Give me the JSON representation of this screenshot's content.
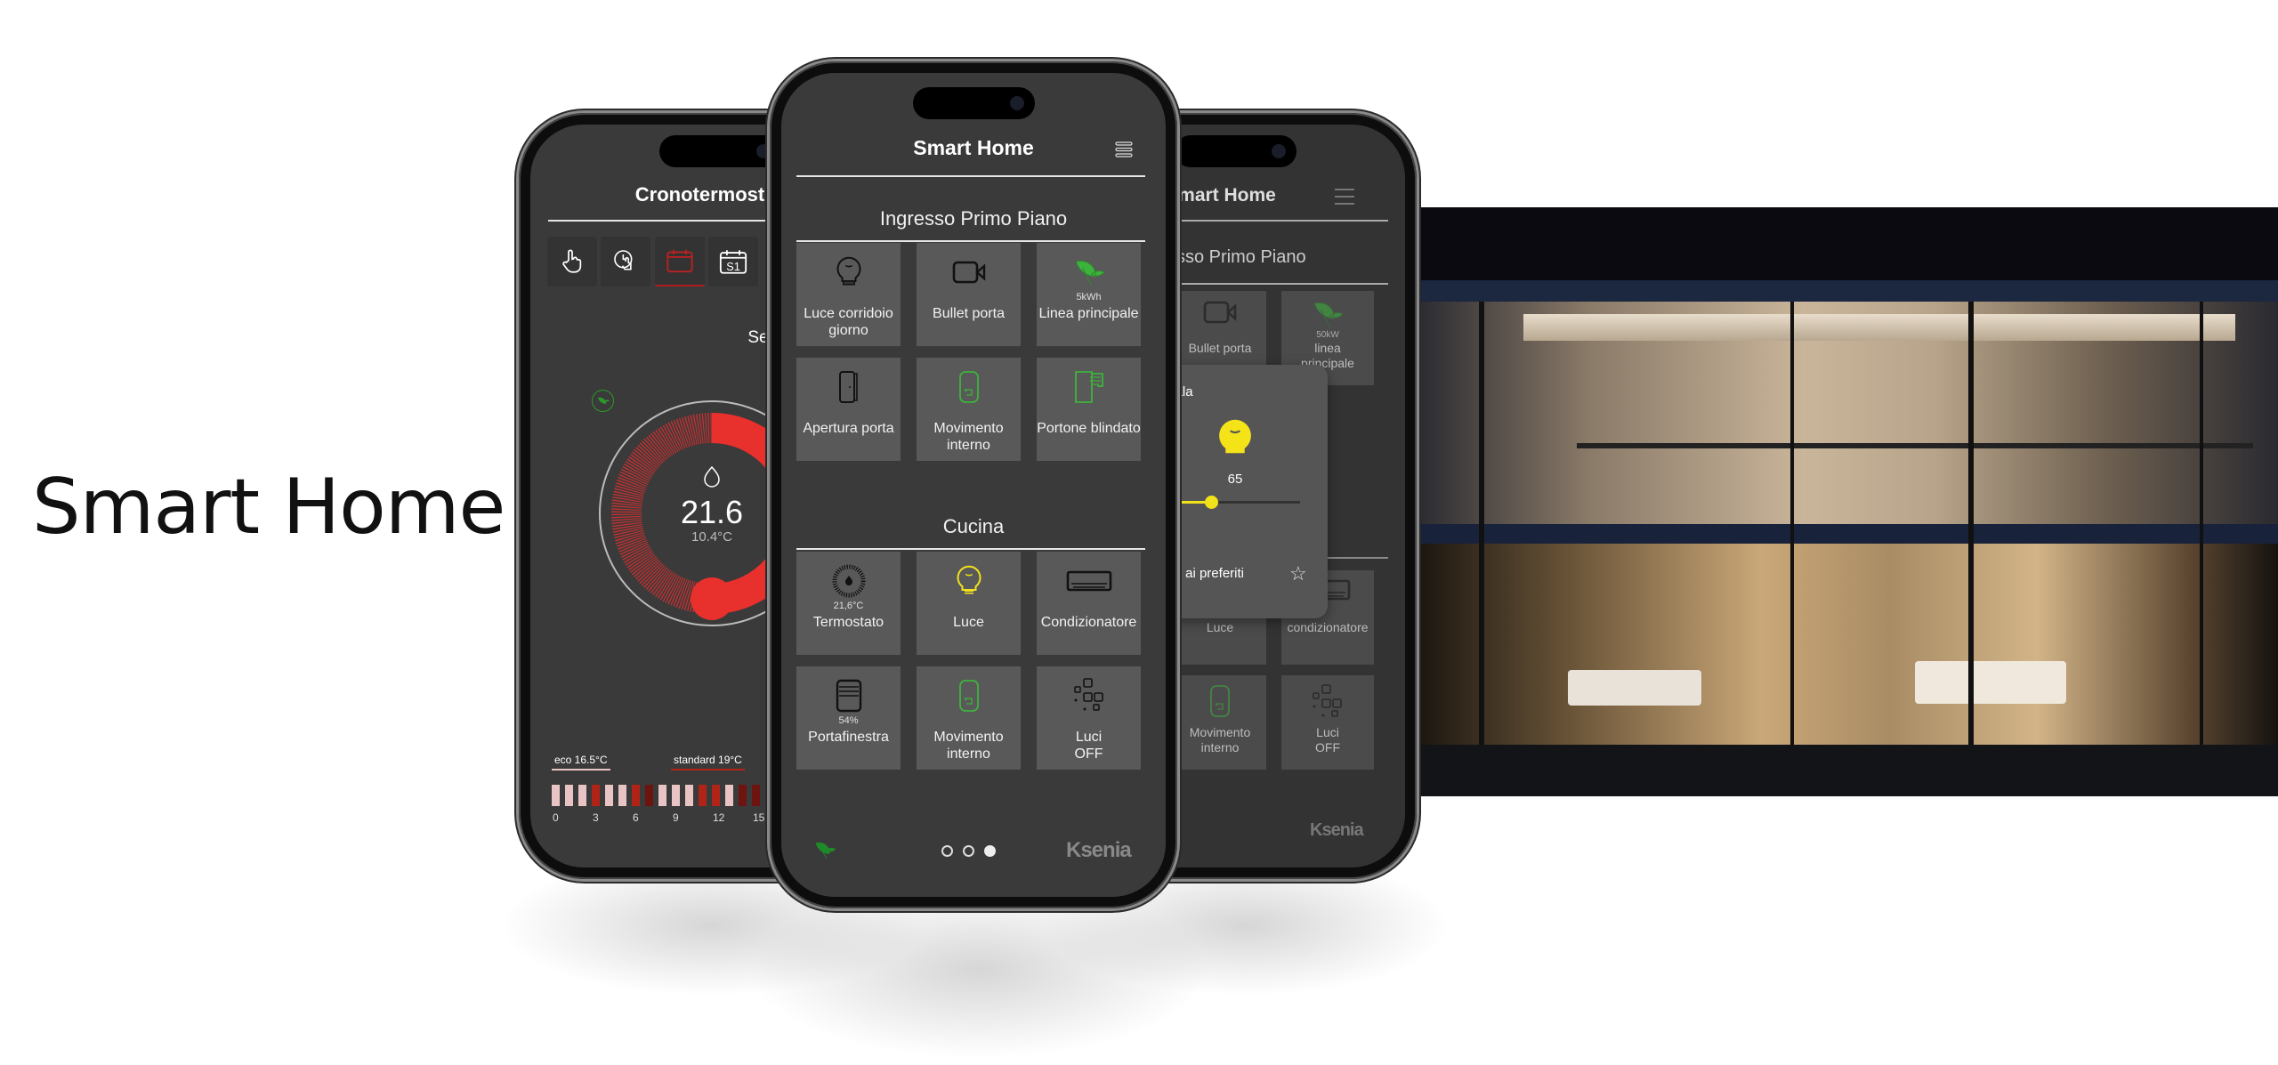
{
  "hero_title": "Smart Home",
  "colors": {
    "accent_green": "#3db33d",
    "accent_red": "#e8302c",
    "accent_yellow": "#f2e21a",
    "tile_bg": "#595959",
    "screen_bg": "#3a3a3a"
  },
  "left_phone": {
    "title": "Cronotermostato",
    "modes": [
      {
        "icon": "hand-pointer-icon",
        "active": false
      },
      {
        "icon": "clock-hand-icon",
        "active": false
      },
      {
        "icon": "calendar-icon",
        "active": true
      },
      {
        "icon": "calendar-s1-icon",
        "label": "S1",
        "active": false
      }
    ],
    "program": "Settimanale",
    "eco_icon": "leaf-icon",
    "temperature": "21.6",
    "external_temperature": "10.4°C",
    "flame_icon": "flame-icon",
    "legend": {
      "eco": "eco 16.5°C",
      "standard": "standard 19°C"
    },
    "hours": [
      {
        "hour": 0,
        "level": "eco"
      },
      {
        "hour": 1,
        "level": "eco"
      },
      {
        "hour": 2,
        "level": "eco"
      },
      {
        "hour": 3,
        "level": "standard"
      },
      {
        "hour": 4,
        "level": "eco"
      },
      {
        "hour": 5,
        "level": "eco"
      },
      {
        "hour": 6,
        "level": "standard"
      },
      {
        "hour": 7,
        "level": "comfort"
      },
      {
        "hour": 8,
        "level": "eco"
      },
      {
        "hour": 9,
        "level": "eco"
      },
      {
        "hour": 10,
        "level": "eco"
      },
      {
        "hour": 11,
        "level": "standard"
      },
      {
        "hour": 12,
        "level": "standard"
      },
      {
        "hour": 13,
        "level": "eco"
      },
      {
        "hour": 14,
        "level": "comfort"
      },
      {
        "hour": 15,
        "level": "comfort"
      },
      {
        "hour": 16,
        "level": "eco"
      }
    ],
    "hour_ticks": [
      "0",
      "3",
      "6",
      "9",
      "12",
      "15"
    ]
  },
  "center_phone": {
    "title": "Smart Home",
    "menu_icon": "hamburger-icon",
    "sections": [
      {
        "name": "Ingresso Primo Piano",
        "tiles": [
          {
            "label": "Luce corridoio giorno",
            "icon": "bulb-off",
            "value": ""
          },
          {
            "label": "Bullet porta",
            "icon": "camera",
            "value": ""
          },
          {
            "label": "Linea principale",
            "icon": "leaf",
            "value": "5kWh"
          },
          {
            "label": "Apertura porta",
            "icon": "door",
            "value": ""
          },
          {
            "label": "Movimento interno",
            "icon": "motion",
            "value": ""
          },
          {
            "label": "Portone blindato",
            "icon": "gate",
            "value": ""
          }
        ]
      },
      {
        "name": "Cucina",
        "tiles": [
          {
            "label": "Termostato",
            "icon": "thermostat",
            "value": "21,6°C"
          },
          {
            "label": "Luce",
            "icon": "bulb-on",
            "value": ""
          },
          {
            "label": "Condizionatore",
            "icon": "ac",
            "value": ""
          },
          {
            "label": "Portafinestra",
            "icon": "shutter",
            "value": "54%"
          },
          {
            "label": "Movimento interno",
            "icon": "motion",
            "value": ""
          },
          {
            "label": "Luci\nOFF",
            "icon": "scenario",
            "value": ""
          }
        ]
      }
    ],
    "pages": 3,
    "current_page": 3,
    "logo": "Ksenia"
  },
  "right_phone": {
    "title": "Smart Home",
    "section": "Ingresso Primo Piano",
    "tiles": [
      {
        "label": "Bullet porta",
        "icon": "camera",
        "value": ""
      },
      {
        "label": "linea\nprincipale",
        "icon": "leaf",
        "value": "50kW"
      },
      {
        "label": "Luce",
        "icon": "bulb-off",
        "value": ""
      },
      {
        "label": "condizionatore",
        "icon": "ac",
        "value": ""
      },
      {
        "label": "Movimento\ninterno",
        "icon": "motion",
        "value": ""
      },
      {
        "label": "Luci\nOFF",
        "icon": "scenario",
        "value": ""
      }
    ],
    "popup": {
      "title": "Luce sala",
      "value": "65",
      "level_percent": 65,
      "favorite_label": "Aggiungi ai preferiti"
    },
    "logo": "Ksenia"
  }
}
